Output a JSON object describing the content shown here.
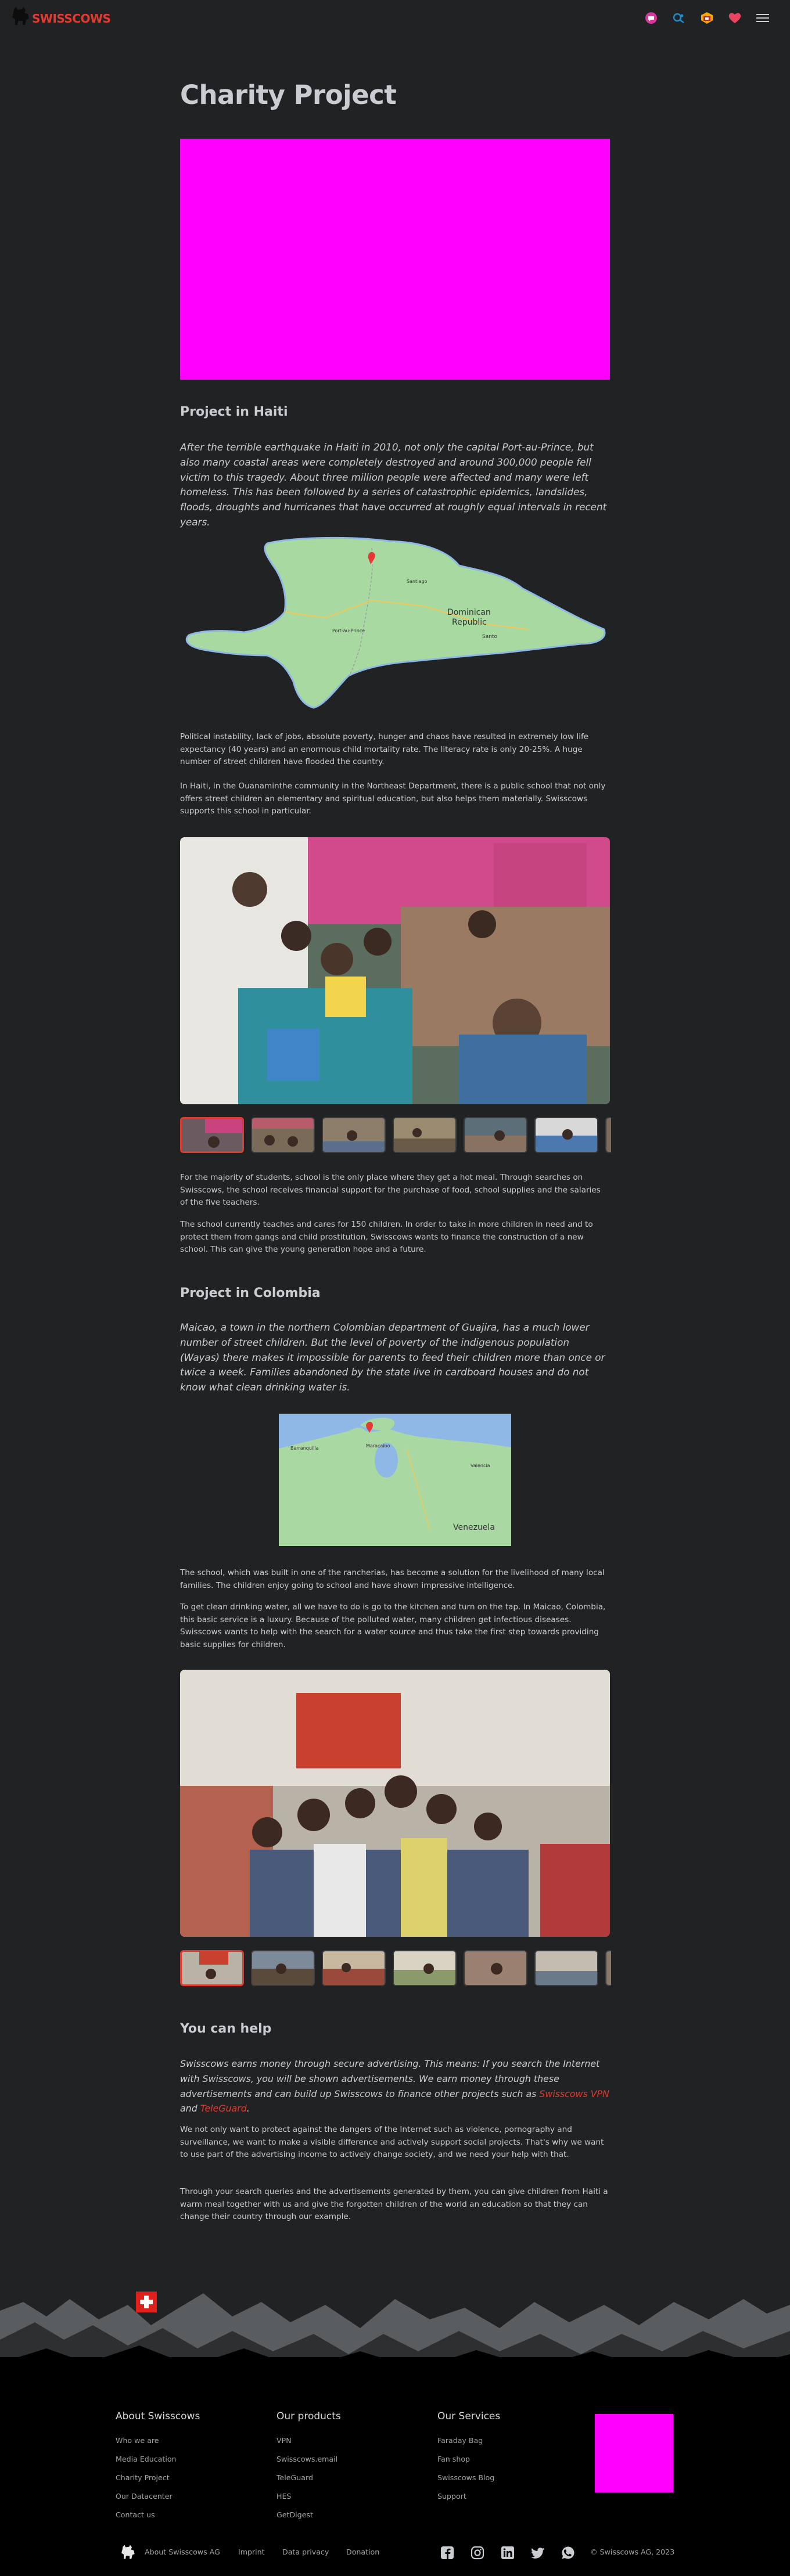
{
  "header": {
    "logo_text": "SWISSCOWS",
    "icons": [
      "chat-icon",
      "teleguard-icon",
      "vpn-icon",
      "heart-icon",
      "menu-icon"
    ]
  },
  "page_title": "Charity Project",
  "haiti": {
    "heading": "Project in Haiti",
    "lead": "After the terrible earthquake in Haiti in 2010, not only the capital Port-au-Prince, but also many coastal areas were completely destroyed and around 300,000 people fell victim to this tragedy. About three million people were affected and many were left homeless. This has been followed by a series of catastrophic epidemics, landslides, floods, droughts and hurricanes that have occurred at roughly equal intervals in recent years.",
    "map_labels": [
      "Dominican",
      "Republic",
      "Santo",
      "Port-au-Prince",
      "Santiago"
    ],
    "p1": "Political instability, lack of jobs, absolute poverty, hunger and chaos have resulted in extremely low life expectancy (40 years) and an enormous child mortality rate. The literacy rate is only 20-25%. A huge number of street children have flooded the country.",
    "p2": "In Haiti, in the Ouanaminthe community in the Northeast Department, there is a public school that not only offers street children an elementary and spiritual education, but also helps them materially. Swisscows supports this school in particular.",
    "p3": "For the majority of students, school is the only place where they get a hot meal. Through searches on Swisscows, the school receives financial support for the purchase of food, school supplies and the salaries of the five teachers.",
    "p4": "The school currently teaches and cares for 150 children. In order to take in more children in need and to protect them from gangs and child prostitution, Swisscows wants to finance the construction of a new school. This can give the young generation hope and a future."
  },
  "colombia": {
    "heading": "Project in Colombia",
    "lead": "Maicao, a town in the northern Colombian department of Guajira, has a much lower number of street children. But the level of poverty of the indigenous population (Wayas) there makes it impossible for parents to feed their children more than once or twice a week. Families abandoned by the state live in cardboard houses and do not know what clean drinking water is.",
    "map_labels": [
      "Venezuela",
      "Barranquilla",
      "Maracaibo",
      "Valencia"
    ],
    "p1": "The school, which was built in one of the rancherias, has become a solution for the livelihood of many local families. The children enjoy going to school and have shown impressive intelligence.",
    "p2": "To get clean drinking water, all we have to do is go to the kitchen and turn on the tap. In Maicao, Colombia, this basic service is a luxury. Because of the polluted water, many children get infectious diseases. Swisscows wants to help with the search for a water source and thus take the first step towards providing basic supplies for children."
  },
  "help": {
    "heading": "You can help",
    "lead_before": "Swisscows earns money through secure advertising. This means: If you search the Internet with Swisscows, you will be shown advertisements. We earn money through these advertisements and can build up Swisscows to finance other projects such as ",
    "link_vpn": "Swisscows VPN",
    "lead_and": " and ",
    "link_teleguard": "TeleGuard",
    "lead_end": ".",
    "p1": "We not only want to protect against the dangers of the Internet such as violence, pornography and surveillance, we want to make a visible difference and actively support social projects. That's why we want to use part of the advertising income to actively change society, and we need your help with that.",
    "p2": "Through your search queries and the advertisements generated by them, you can give children from Haiti a warm meal together with us and give the forgotten children of the world an education so that they can change their country through our example."
  },
  "footer": {
    "col1": {
      "title": "About Swisscows",
      "links": [
        "Who we are",
        "Media Education",
        "Charity Project",
        "Our Datacenter",
        "Contact us"
      ]
    },
    "col2": {
      "title": "Our products",
      "links": [
        "VPN",
        "Swisscows.email",
        "TeleGuard",
        "HES",
        "GetDigest"
      ]
    },
    "col3": {
      "title": "Our Services",
      "links": [
        "Faraday Bag",
        "Fan shop",
        "Swisscows Blog",
        "Support"
      ]
    },
    "bottom_links": [
      "About Swisscows AG",
      "Imprint",
      "Data privacy",
      "Donation"
    ],
    "social": [
      "facebook-icon",
      "instagram-icon",
      "linkedin-icon",
      "twitter-icon",
      "whatsapp-icon"
    ],
    "copyright": "© Swisscows AG, 2023"
  },
  "colors": {
    "accent": "#e03b30",
    "background": "#202224",
    "placeholder": "#ff00ff"
  }
}
